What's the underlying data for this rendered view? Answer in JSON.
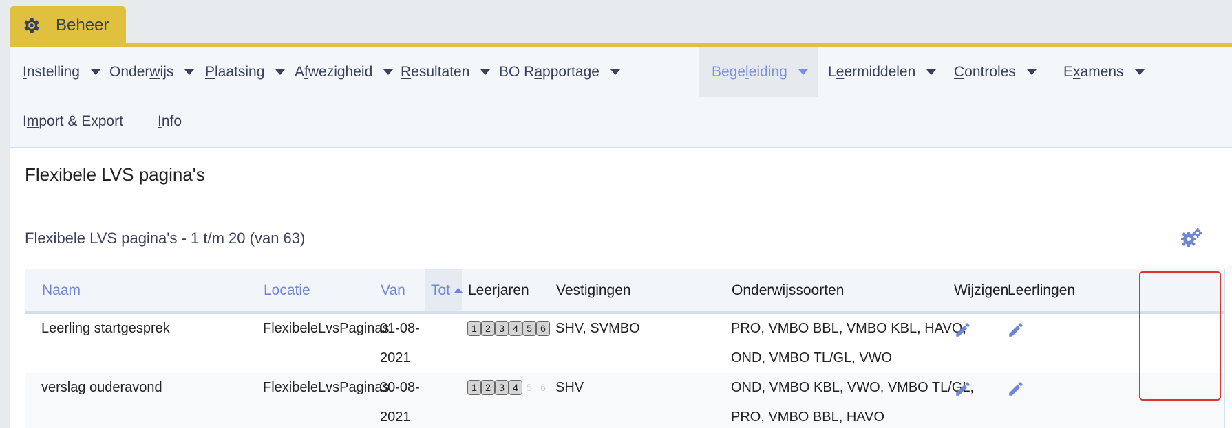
{
  "top_tab": {
    "label": "Beheer",
    "icon": "gear-icon"
  },
  "menu": {
    "items": [
      {
        "label_pre": "",
        "underline": "I",
        "label_post": "nstelling",
        "active": false
      },
      {
        "label_pre": "Onder",
        "underline": "w",
        "label_post": "ijs",
        "active": false
      },
      {
        "label_pre": "",
        "underline": "P",
        "label_post": "laatsing",
        "active": false
      },
      {
        "label_pre": "A",
        "underline": "f",
        "label_post": "wezigheid",
        "active": false
      },
      {
        "label_pre": "",
        "underline": "R",
        "label_post": "esultaten",
        "active": false
      },
      {
        "label_pre": "BO R",
        "underline": "a",
        "label_post": "pportage",
        "active": false
      },
      {
        "label_pre": "Bege",
        "underline": "l",
        "label_post": "eiding",
        "active": true
      },
      {
        "label_pre": "L",
        "underline": "e",
        "label_post": "ermiddelen",
        "active": false
      },
      {
        "label_pre": "",
        "underline": "C",
        "label_post": "ontroles",
        "active": false
      },
      {
        "label_pre": "E",
        "underline": "x",
        "label_post": "amens",
        "active": false
      },
      {
        "label_pre": "I",
        "underline": "m",
        "label_post": "port & Export",
        "active": false
      },
      {
        "label_pre": "",
        "underline": "I",
        "label_post": "nfo",
        "active": false
      }
    ]
  },
  "page": {
    "title": "Flexibele LVS pagina's",
    "subtitle": "Flexibele LVS pagina's - 1 t/m 20 (van 63)",
    "settings_icon": "cogs-icon"
  },
  "table": {
    "columns": {
      "naam": "Naam",
      "locatie": "Locatie",
      "van": "Van",
      "tot": "Tot",
      "leerjaren": "Leerjaren",
      "vestigingen": "Vestigingen",
      "onderwijssoorten": "Onderwijssoorten",
      "wijzigen": "Wijzigen",
      "leerlingen": "Leerlingen"
    },
    "rows": [
      {
        "naam": "Leerling startgesprek",
        "locatie": "FlexibeleLvsPaginas",
        "van_1": "01-08-",
        "van_2": "2021",
        "tot": "",
        "years": [
          "1",
          "2",
          "3",
          "4",
          "5",
          "6"
        ],
        "years_active": [
          true,
          true,
          true,
          true,
          true,
          true
        ],
        "vestigingen": "SHV, SVMBO",
        "onderwijssoorten_1": "PRO, VMBO BBL, VMBO KBL, HAVO,",
        "onderwijssoorten_2": "OND, VMBO TL/GL, VWO"
      },
      {
        "naam": "verslag ouderavond",
        "locatie": "FlexibeleLvsPaginas",
        "van_1": "30-08-",
        "van_2": "2021",
        "tot": "",
        "years": [
          "1",
          "2",
          "3",
          "4",
          "5",
          "6"
        ],
        "years_active": [
          true,
          true,
          true,
          true,
          false,
          false
        ],
        "vestigingen": "SHV",
        "onderwijssoorten_1": "OND, VMBO KBL, VWO, VMBO TL/GL,",
        "onderwijssoorten_2": "PRO, VMBO BBL, HAVO"
      }
    ]
  },
  "colors": {
    "accent_yellow": "#dfc03f",
    "link_blue": "#6f86d8",
    "highlight_red": "#d33333"
  }
}
